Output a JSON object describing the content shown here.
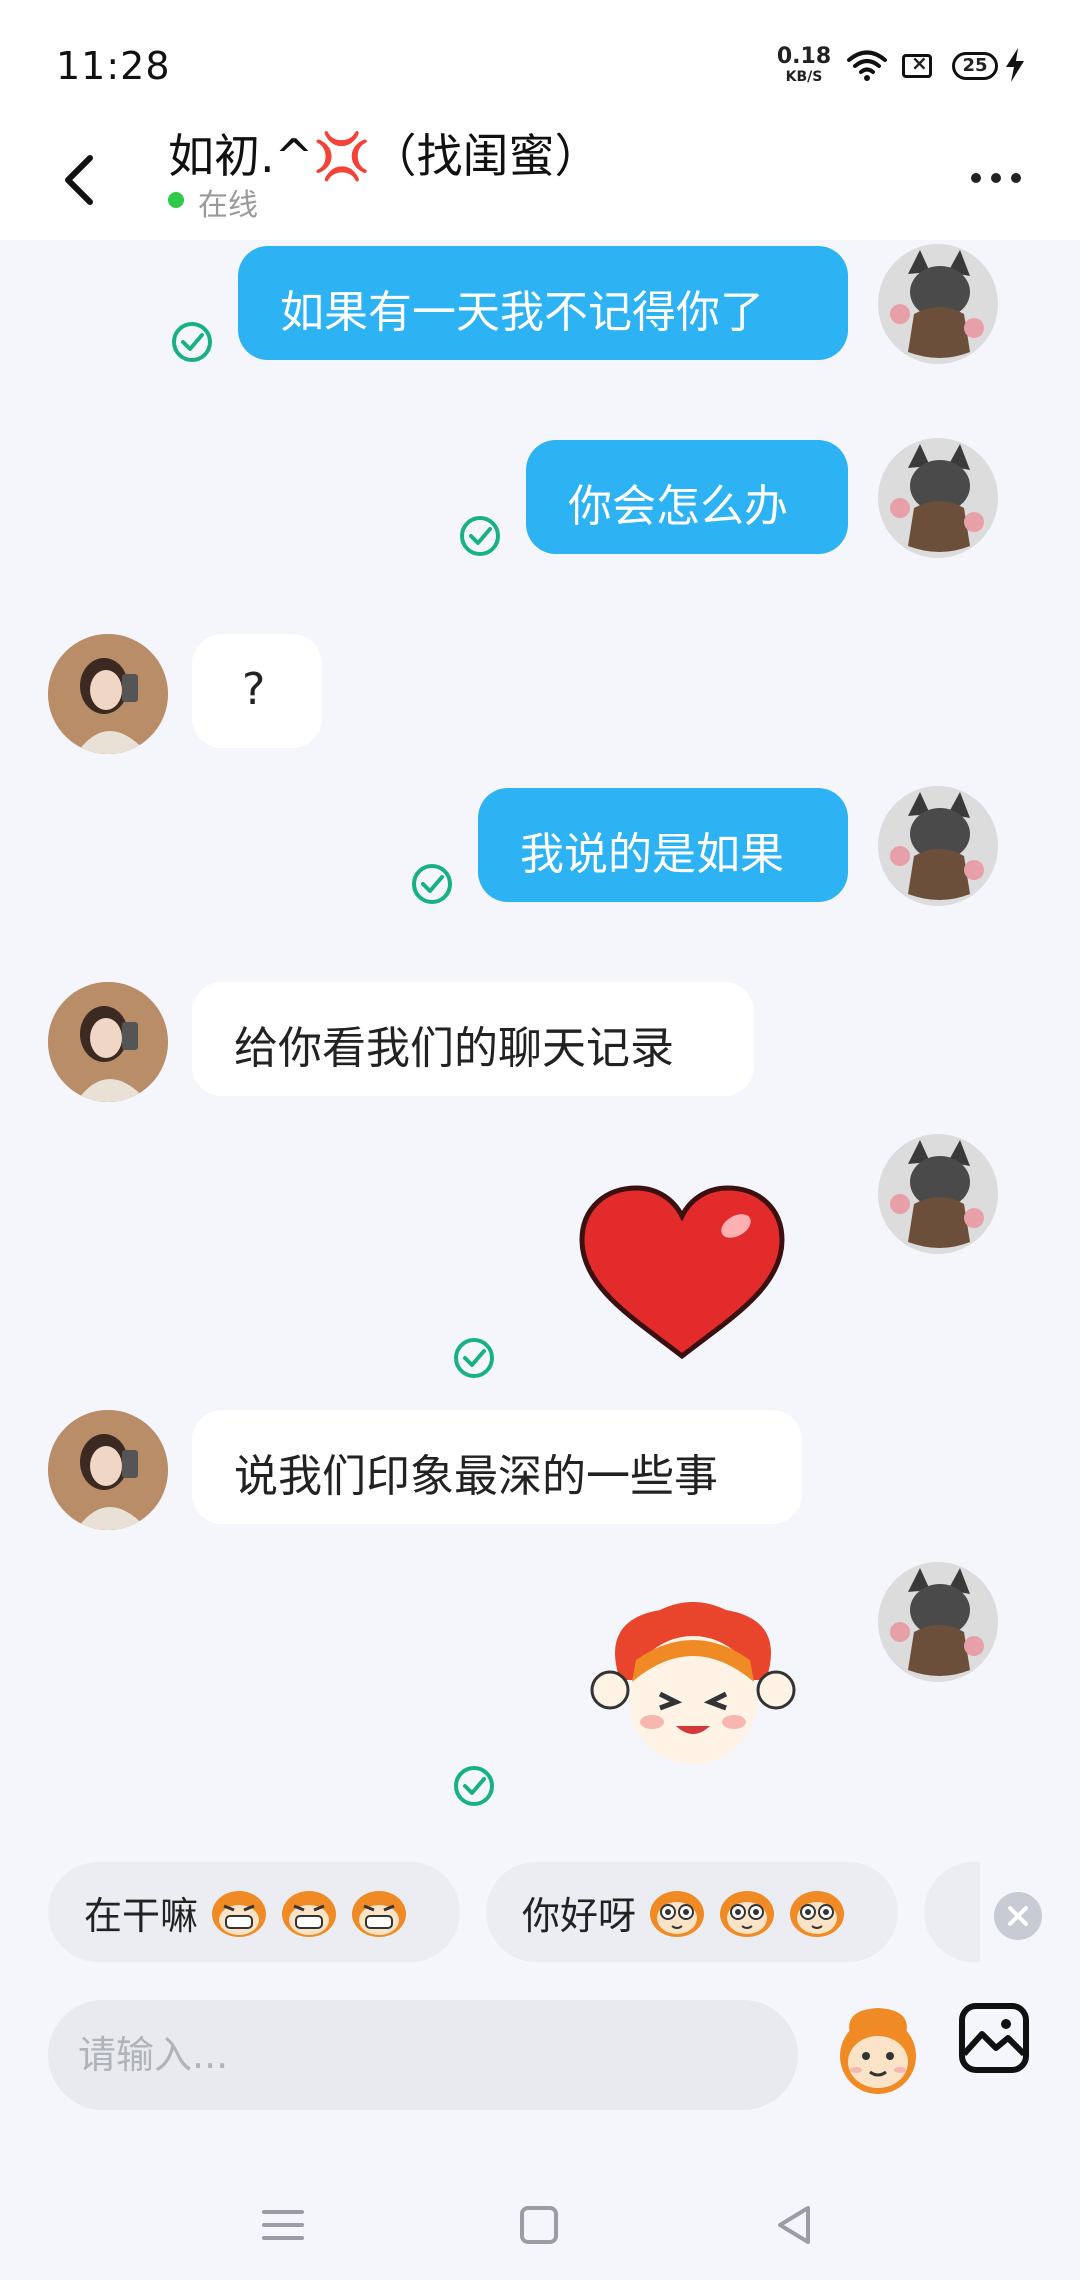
{
  "status_bar": {
    "time": "11:28",
    "net_speed_value": "0.18",
    "net_speed_unit": "KB/S",
    "battery": "25"
  },
  "header": {
    "contact_name": "如初.^💢（找闺蜜）",
    "status": "在线",
    "online_color": "#2ec94a"
  },
  "messages": [
    {
      "side": "mine",
      "type": "text",
      "text": "如果有一天我不记得你了",
      "read": true
    },
    {
      "side": "mine",
      "type": "text",
      "text": "你会怎么办",
      "read": true
    },
    {
      "side": "theirs",
      "type": "text",
      "text": "?"
    },
    {
      "side": "mine",
      "type": "text",
      "text": "我说的是如果",
      "read": true
    },
    {
      "side": "theirs",
      "type": "text",
      "text": "给你看我们的聊天记录"
    },
    {
      "side": "mine",
      "type": "sticker",
      "sticker": "red-heart",
      "read": true
    },
    {
      "side": "theirs",
      "type": "text",
      "text": "说我们印象最深的一些事"
    },
    {
      "side": "mine",
      "type": "sticker",
      "sticker": "cartoon-girl-holding-heart",
      "read": true
    }
  ],
  "quick_replies": [
    {
      "text": "在干嘛",
      "emoji": "grinning-monkey-face"
    },
    {
      "text": "你好呀",
      "emoji": "big-eyed-monkey-face"
    }
  ],
  "input": {
    "placeholder": "请输入..."
  },
  "colors": {
    "my_bubble": "#2db2f3",
    "their_bubble": "#ffffff",
    "read_check": "#18b184",
    "background": "#f4f6fb"
  },
  "icons": {
    "back": "chevron-left-icon",
    "more": "more-dots-icon",
    "emoji": "monkey-emoji-icon",
    "image": "image-picker-icon"
  }
}
